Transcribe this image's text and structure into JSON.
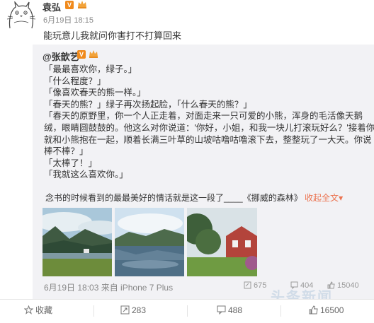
{
  "post": {
    "author": "袁弘",
    "verified_badge": "V",
    "time": "6月19日 18:15",
    "text": "能玩意儿我就问你害打不打算回来"
  },
  "repost": {
    "author": "@张歆艺",
    "verified_badge": "V",
    "lines": [
      "「最最喜欢你，绿子。」",
      "「什么程度？」",
      "「像喜欢春天的熊一样。」",
      "「春天的熊？」绿子再次扬起脸，「什么春天的熊？」",
      "「春天的原野里，你一个人正走着，对面走来一只可爱的小熊，浑身的毛活像天鹅",
      "绒，眼睛圆鼓鼓的。他这么对你说道：'你好，小姐，和我一块儿打滚玩好么？'接着你",
      "就和小熊抱在一起，顺着长满三叶草的山坡咕噜咕噜滚下去，整整玩了一大天。你说",
      "棒不棒？」",
      "「太棒了！」",
      "「我就这么喜欢你。」"
    ],
    "caption_text": "念书的时候看到的最最美好的情话就是这一段了____《挪威的森林》",
    "caption_more": "收起全文",
    "caption_more_arrow": "▾",
    "meta": "6月19日 18:03 来自 iPhone 7 Plus",
    "repost_count": "675",
    "comment_count": "404",
    "like_count": "15040",
    "images": [
      "lake-mountain-photo",
      "lake-reflection-photo",
      "red-barn-photo"
    ]
  },
  "actions": {
    "favorite": "收藏",
    "repost": "283",
    "comment": "488",
    "like": "16500"
  },
  "watermark": "头条新闻",
  "colors": {
    "link": "#eb7350",
    "repost_bg": "#f2f2f5",
    "badge": "#f08a1c"
  }
}
